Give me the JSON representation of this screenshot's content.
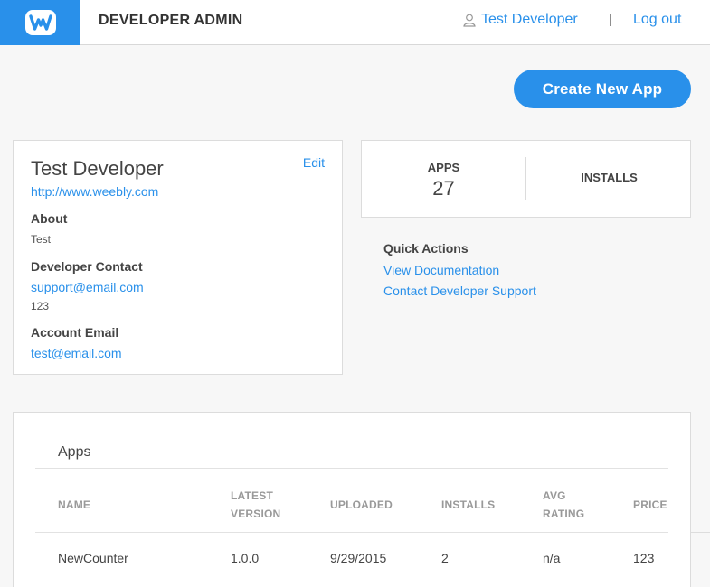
{
  "header": {
    "brand": "DEVELOPER ADMIN",
    "user_name": "Test Developer",
    "separator": "|",
    "logout_label": "Log out"
  },
  "actions": {
    "create_app_label": "Create New App"
  },
  "profile": {
    "name": "Test Developer",
    "edit_label": "Edit",
    "website": "http://www.weebly.com",
    "about_label": "About",
    "about_value": "Test",
    "contact_label": "Developer Contact",
    "contact_email": "support@email.com",
    "contact_phone": "123",
    "account_email_label": "Account Email",
    "account_email": "test@email.com"
  },
  "stats": {
    "apps_label": "APPS",
    "apps_count": "27",
    "installs_label": "INSTALLS"
  },
  "quick_actions": {
    "title": "Quick Actions",
    "links": [
      "View Documentation",
      "Contact Developer Support"
    ]
  },
  "apps_table": {
    "title": "Apps",
    "columns": [
      "NAME",
      "LATEST VERSION",
      "UPLOADED",
      "INSTALLS",
      "AVG RATING",
      "PRICE"
    ],
    "rows": [
      {
        "name": "NewCounter",
        "version": "1.0.0",
        "uploaded": "9/29/2015",
        "installs": "2",
        "rating": "n/a",
        "price": "123"
      }
    ]
  },
  "colors": {
    "accent": "#2990ea",
    "background": "#f7f7f7"
  },
  "icons": {
    "logo": "weebly-w-logo",
    "user": "user-icon"
  }
}
